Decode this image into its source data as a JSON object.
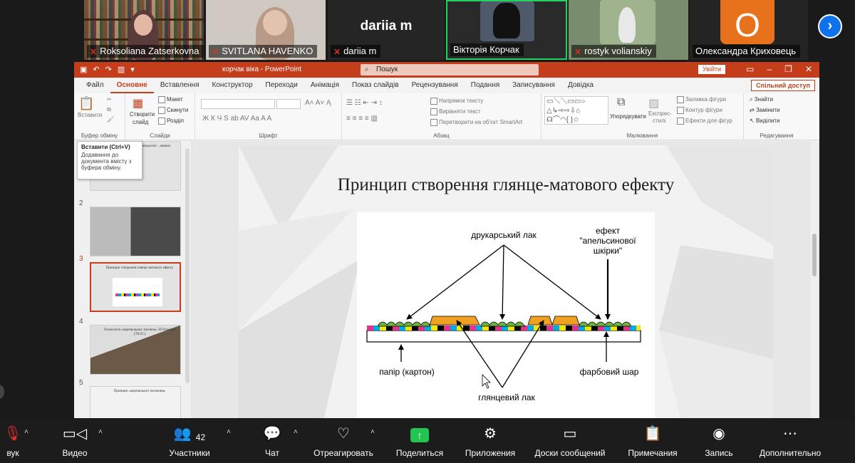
{
  "participants": [
    {
      "name": "Roksoliana Zatserkovna",
      "muted": true
    },
    {
      "name": "SVITLANA HAVENKO",
      "muted": true
    },
    {
      "name": "dariia m",
      "muted": true,
      "display_text": "dariia m"
    },
    {
      "name": "Вікторія Корчак",
      "muted": false,
      "active_speaker": true
    },
    {
      "name": "rostyk volianskiy",
      "muted": true
    },
    {
      "name": "Олександра Криховець",
      "muted": false,
      "avatar_letter": "O",
      "avatar_color": "#e8711b"
    }
  ],
  "ppt": {
    "doc_title": "корчак віка  -  PowerPoint",
    "search_placeholder": "Пошук",
    "sign_in": "Увійти",
    "share": "Спільний доступ",
    "tabs": [
      "Файл",
      "Основне",
      "Вставлення",
      "Конструктор",
      "Переходи",
      "Анімація",
      "Показ слайдів",
      "Рецензування",
      "Подання",
      "Записування",
      "Довідка"
    ],
    "active_tab": "Основне",
    "ribbon": {
      "paste": "Вставити",
      "new_slide_1": "Створити",
      "new_slide_2": "слайд",
      "layout": "Макет",
      "reset": "Скинути",
      "section": "Розділ",
      "text_direction": "Напрямок тексту",
      "align_text": "Вирівняти текст",
      "smartart": "Перетворити на об'єкт SmartArt",
      "arrange": "Упорядкувати",
      "quick_styles_1": "Експрес-",
      "quick_styles_2": "стилі",
      "shape_fill": "Заливка фігури",
      "shape_outline": "Контур фігури",
      "shape_effects": "Ефекти для фігур",
      "find": "Знайти",
      "replace": "Замінити",
      "select": "Виділити",
      "groups": {
        "clipboard": "Буфер обміну",
        "slides": "Слайди",
        "font": "Шрифт",
        "paragraph": "Абзац",
        "drawing": "Малювання",
        "editing": "Редагування"
      }
    },
    "tooltip": {
      "title": "Вставити (Ctrl+V)",
      "body": "Додавання до документа вмісту з буфера обміну."
    },
    "thumbnails": [
      {
        "num": "",
        "text": "...ості підвищення ...конкурсної ...ованих"
      },
      {
        "num": "2",
        "text": ""
      },
      {
        "num": "3",
        "text": "Принцип створення глянце-матового ефекту",
        "selected": true
      },
      {
        "num": "4",
        "text": "Технологія «мертвальних тиснень» 3D Emotion (TSGC)"
      },
      {
        "num": "5",
        "text": "Принцип «мертвальної тиснення»"
      }
    ],
    "slide": {
      "title": "Принцип створення глянце-матового ефекту",
      "labels": {
        "printing_varnish": "друкарський лак",
        "orange_peel_1": "ефект",
        "orange_peel_2": "\"апельсинової",
        "orange_peel_3": "шкірки\"",
        "paper": "папір (картон)",
        "ink_layer": "фарбовий шар",
        "gloss_varnish": "глянцевий лак"
      }
    }
  },
  "toolbar": {
    "audio": "вук",
    "video": "Видео",
    "participants": "Участники",
    "participants_count": "42",
    "chat": "Чат",
    "react": "Отреагировать",
    "share": "Поделиться",
    "apps": "Приложения",
    "whiteboards": "Доски сообщений",
    "notes": "Примечания",
    "record": "Запись",
    "more": "Дополнительно"
  }
}
